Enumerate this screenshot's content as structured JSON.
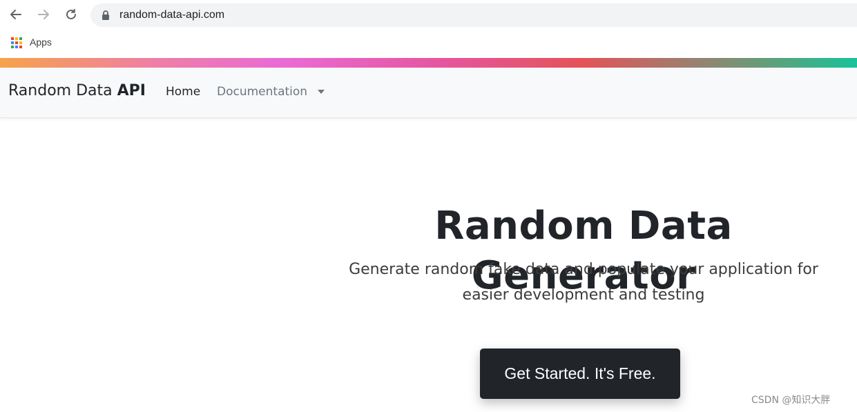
{
  "browser": {
    "url": "random-data-api.com",
    "bookmarks": {
      "apps_label": "Apps"
    }
  },
  "navbar": {
    "brand_prefix": "Random Data ",
    "brand_strong": "API",
    "home_label": "Home",
    "documentation_label": "Documentation"
  },
  "hero": {
    "title": "Random Data Generator",
    "subtitle": "Generate random fake data and populate your application for easier development and testing",
    "cta_label": "Get Started. It's Free."
  },
  "watermark": "CSDN @知识大胖",
  "icons": {
    "back": "arrow-left-icon",
    "forward": "arrow-right-icon",
    "reload": "reload-icon",
    "lock": "lock-icon",
    "apps": "apps-grid-icon",
    "dropdown": "caret-down-icon"
  },
  "colors": {
    "navbar_bg": "#f8f9fa",
    "cta_bg": "#212529",
    "text_dark": "#212529",
    "text_muted": "#6c757d"
  }
}
